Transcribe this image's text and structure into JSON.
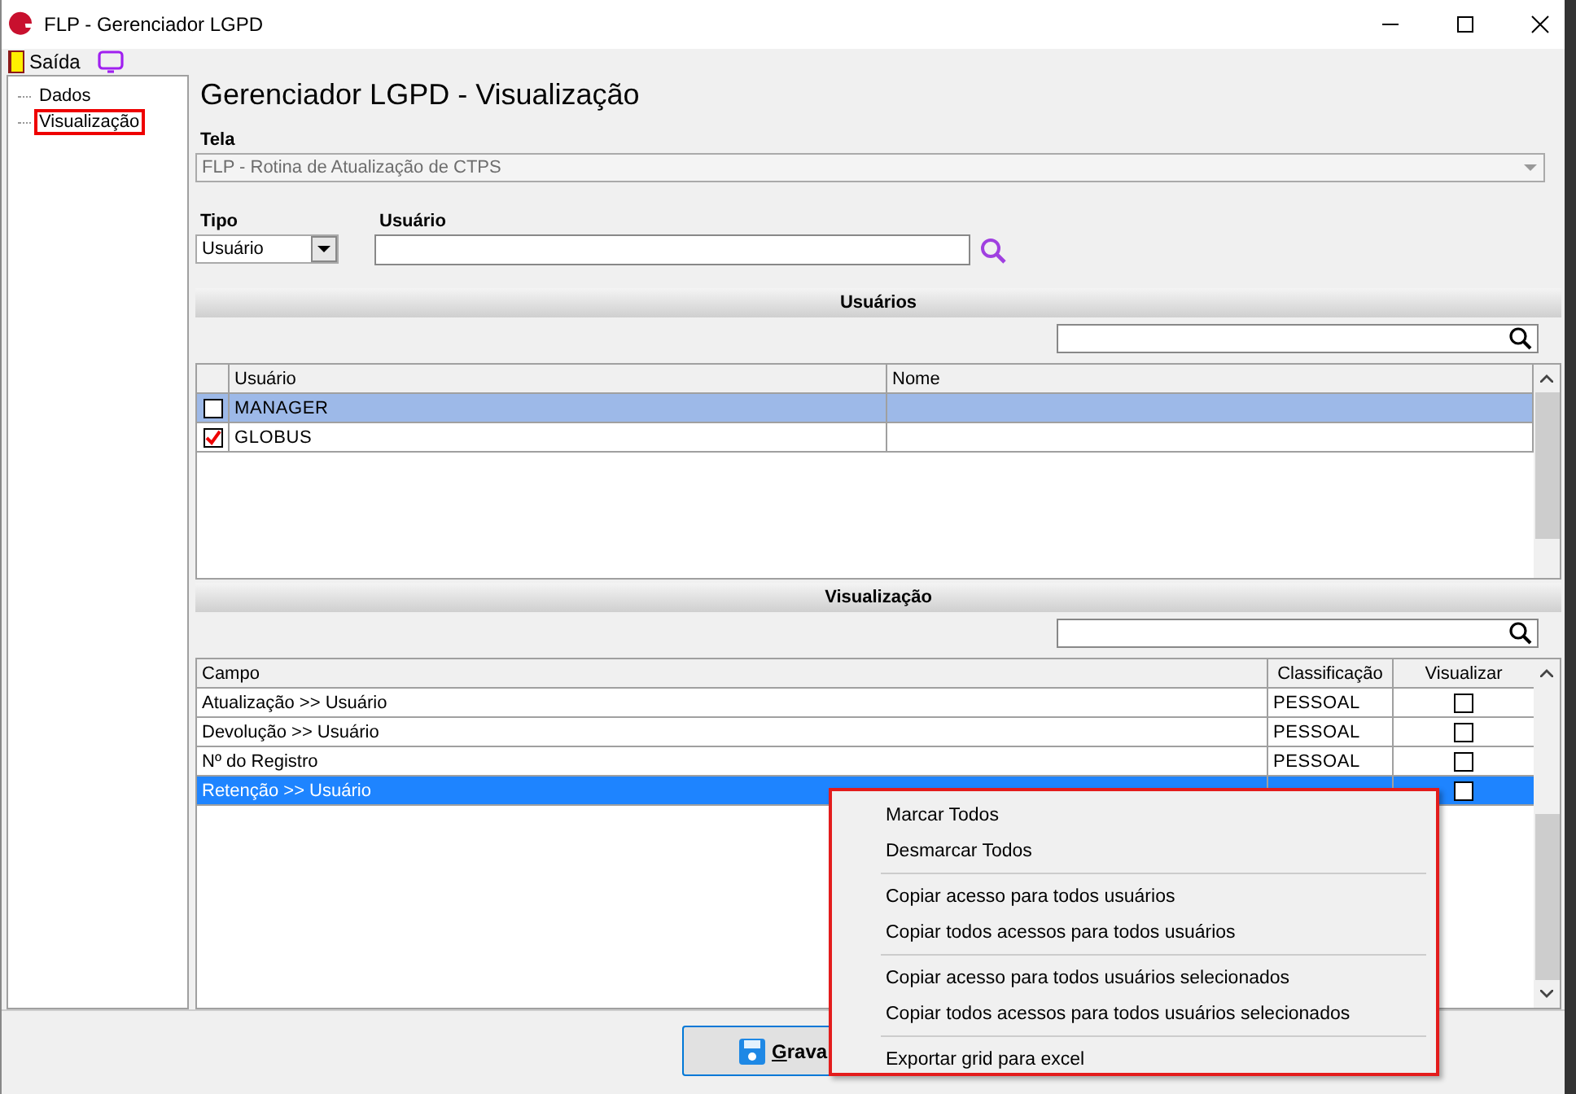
{
  "window": {
    "title": "FLP - Gerenciador LGPD"
  },
  "menu": [
    {
      "label": "Saída"
    }
  ],
  "tree": [
    {
      "label": "Dados",
      "selected": false
    },
    {
      "label": "Visualização",
      "selected": true
    }
  ],
  "heading": "Gerenciador LGPD - Visualização",
  "tela": {
    "label": "Tela",
    "value": "FLP - Rotina de Atualização de CTPS",
    "disabled": true
  },
  "tipo": {
    "label": "Tipo",
    "value": "Usuário"
  },
  "usuario": {
    "label": "Usuário"
  },
  "users": {
    "title": "Usuários",
    "columns": [
      "Usuário",
      "Nome"
    ],
    "rows": [
      {
        "usuario": "MANAGER",
        "checked": false,
        "selected": true
      },
      {
        "usuario": "GLOBUS",
        "checked": true,
        "selected": false
      }
    ]
  },
  "visualizacao": {
    "title": "Visualização",
    "columns": [
      "Campo",
      "Classificação",
      "Visualizar"
    ],
    "rows": [
      {
        "campo": "Atualização >> Usuário",
        "classificacao": "PESSOAL",
        "visualizar": false,
        "selected": false
      },
      {
        "campo": "Devolução >> Usuário",
        "classificacao": "PESSOAL",
        "visualizar": false,
        "selected": false
      },
      {
        "campo": "Nº do Registro",
        "classificacao": "PESSOAL",
        "visualizar": false,
        "selected": false
      },
      {
        "campo": "Retenção >> Usuário",
        "visualizar": false,
        "selected": true
      }
    ]
  },
  "context_menu": [
    [
      "Marcar Todos",
      "Desmarcar Todos"
    ],
    [
      "Copiar acesso para todos usuários",
      "Copiar todos acessos para todos usuários"
    ],
    [
      "Copiar acesso para todos usuários selecionados",
      "Copiar todos acessos para todos usuários selecionados"
    ],
    [
      "Exportar grid para excel"
    ]
  ],
  "save_button": {
    "label": "Grava"
  }
}
